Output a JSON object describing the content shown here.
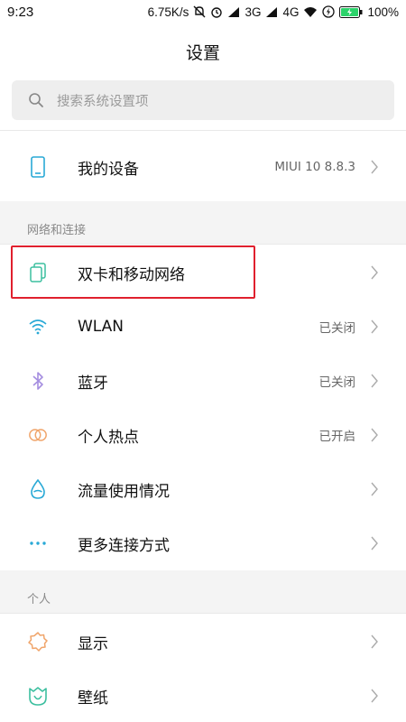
{
  "status_bar": {
    "time": "9:23",
    "speed": "6.75K/s",
    "net1": "3G",
    "net2": "4G",
    "battery": "100%"
  },
  "header": {
    "title": "设置"
  },
  "search": {
    "placeholder": "搜索系统设置项"
  },
  "device": {
    "label": "我的设备",
    "value": "MIUI 10 8.8.3"
  },
  "sections": {
    "network": "网络和连接",
    "personal": "个人"
  },
  "network_items": [
    {
      "label": "双卡和移动网络",
      "value": ""
    },
    {
      "label": "WLAN",
      "value": "已关闭"
    },
    {
      "label": "蓝牙",
      "value": "已关闭"
    },
    {
      "label": "个人热点",
      "value": "已开启"
    },
    {
      "label": "流量使用情况",
      "value": ""
    },
    {
      "label": "更多连接方式",
      "value": ""
    }
  ],
  "personal_items": [
    {
      "label": "显示",
      "value": ""
    },
    {
      "label": "壁纸",
      "value": ""
    }
  ],
  "colors": {
    "accent": "#29a9d6",
    "highlight": "#e0202e",
    "bluetooth": "#a58ee0",
    "hotspot": "#f0a56b",
    "display": "#f0a56b",
    "wallpaper": "#3cbf9f"
  }
}
